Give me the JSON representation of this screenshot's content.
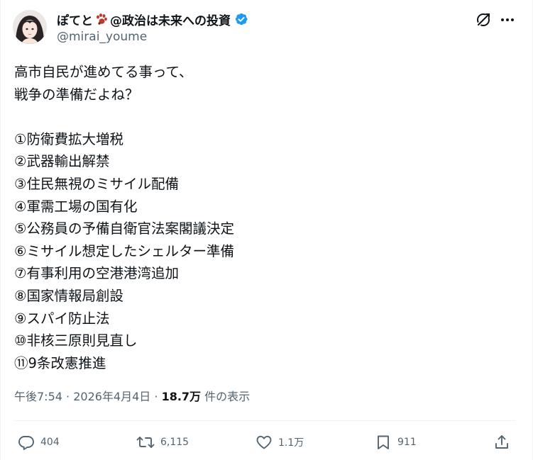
{
  "author": {
    "display_name_prefix": "ぽてと",
    "display_name_suffix": "@政治は未来への投資",
    "handle": "@mirai_youme",
    "verified_color": "#1d9bf0",
    "paw_color": "#c0392b"
  },
  "tweet": {
    "lines": [
      "高市自民が進めてる事って、",
      "戦争の準備だよね？",
      "",
      "①防衛費拡大増税",
      "②武器輸出解禁",
      "③住民無視のミサイル配備",
      "④軍需工場の国有化",
      "⑤公務員の予備自衛官法案閣議決定",
      "⑥ミサイル想定したシェルター準備",
      "⑦有事利用の空港港湾追加",
      "⑧国家情報局創設",
      "⑨スパイ防止法",
      "⑩非核三原則見直し",
      "⑪9条改憲推進"
    ]
  },
  "meta": {
    "time": "午後7:54",
    "sep1": " · ",
    "date": "2026年4月4日",
    "sep2": " · ",
    "views": "18.7万",
    "views_label": " 件の表示"
  },
  "actions": {
    "replies": "404",
    "reposts": "6,115",
    "likes": "1.1万",
    "bookmarks": "911"
  },
  "icons": {
    "grok": "grok-icon",
    "more": "more-icon",
    "reply": "reply-icon",
    "repost": "repost-icon",
    "like": "like-icon",
    "bookmark": "bookmark-icon",
    "share": "share-icon"
  }
}
